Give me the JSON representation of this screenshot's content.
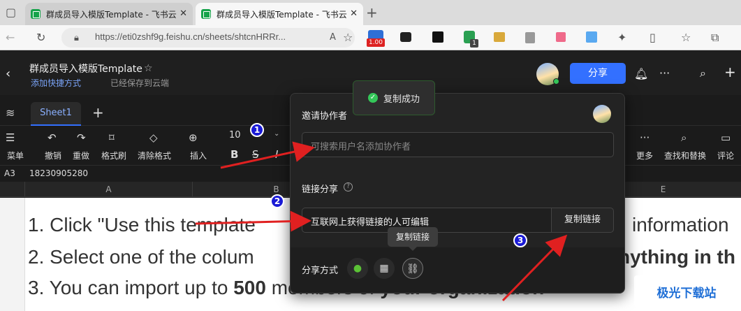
{
  "browser": {
    "tabs": [
      {
        "title": "群成员导入模版Template - 飞书云"
      },
      {
        "title": "群成员导入模版Template - 飞书云"
      }
    ],
    "url": "https://eti0zshf9g.feishu.cn/sheets/shtcnHRRr...",
    "ext_badges": {
      "b1": "1.00",
      "b2": "1"
    }
  },
  "app": {
    "doc_title": "群成员导入模版Template",
    "add_shortcut": "添加快捷方式",
    "saved_status": "已经保存到云端",
    "share_button": "分享"
  },
  "sheet": {
    "tab": "Sheet1",
    "toolbar": {
      "menu": "菜单",
      "undo": "撤销",
      "redo": "重做",
      "format_painter": "格式刷",
      "clear_format": "清除格式",
      "insert": "插入",
      "font_size": "10",
      "more": "更多",
      "find_replace": "查找和替换",
      "comment": "评论"
    },
    "cell_ref": "A3",
    "cell_value": "18230905280",
    "columns": [
      "A",
      "B",
      "E"
    ],
    "lines": [
      {
        "left": "1. Click \"Use this template",
        "right": "information"
      },
      {
        "left": "2. Select one of the colum",
        "right": "nything in th"
      },
      {
        "left": "3. You can import up to ",
        "bold": "500",
        "mid": " members of ",
        "bold2": "your organization"
      }
    ]
  },
  "share_panel": {
    "invite_title": "邀请协作者",
    "invite_placeholder": "可搜索用户名添加协作者",
    "link_share_title": "链接分享",
    "link_permission": "互联网上获得链接的人可编辑",
    "copy_link": "复制链接",
    "tooltip": "复制链接",
    "share_via": "分享方式",
    "toast": "复制成功"
  },
  "annotations": [
    "1",
    "2",
    "3"
  ],
  "watermark": "极光下载站",
  "colors": {
    "accent": "#3370ff",
    "annotation": "#1a1ad6",
    "arrow": "#e02020"
  }
}
